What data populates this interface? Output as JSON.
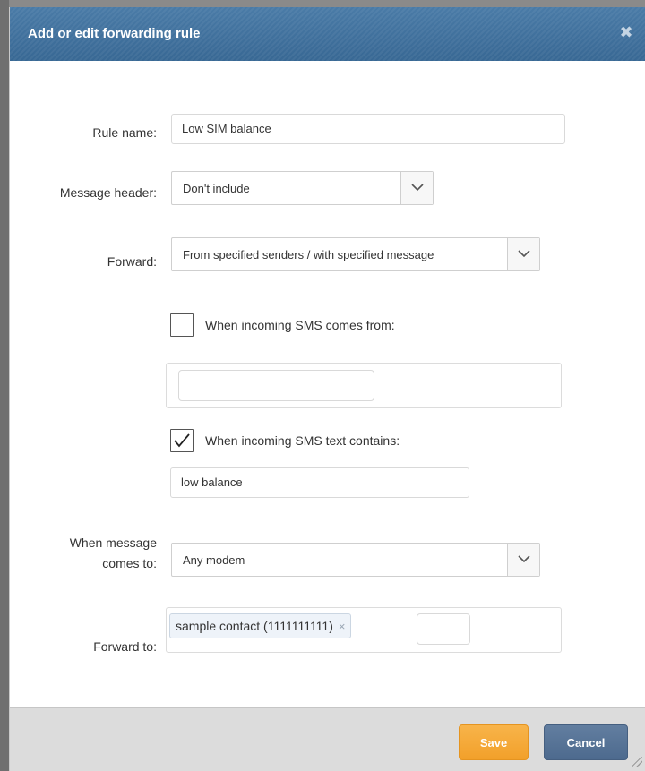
{
  "dialog": {
    "title": "Add or edit forwarding rule",
    "close_icon": "close-icon"
  },
  "form": {
    "rule_name": {
      "label": "Rule name:",
      "value": "Low SIM balance"
    },
    "message_header": {
      "label": "Message header:",
      "selected": "Don't include"
    },
    "forward": {
      "label": "Forward:",
      "selected": "From specified senders / with specified message"
    },
    "incoming_from": {
      "label": "When incoming SMS comes from:",
      "checked": false,
      "value": ""
    },
    "text_contains": {
      "label": "When incoming SMS text contains:",
      "checked": true,
      "value": "low balance"
    },
    "comes_to": {
      "label_line1": "When message",
      "label_line2": "comes to:",
      "selected": "Any modem"
    },
    "forward_to": {
      "label": "Forward to:",
      "contacts": [
        {
          "name": "sample contact (1111111111)",
          "remove": "×"
        }
      ]
    }
  },
  "footer": {
    "save_label": "Save",
    "cancel_label": "Cancel"
  },
  "colors": {
    "titlebar": "#3f6f9c",
    "save": "#f4a634",
    "cancel": "#56729a"
  }
}
